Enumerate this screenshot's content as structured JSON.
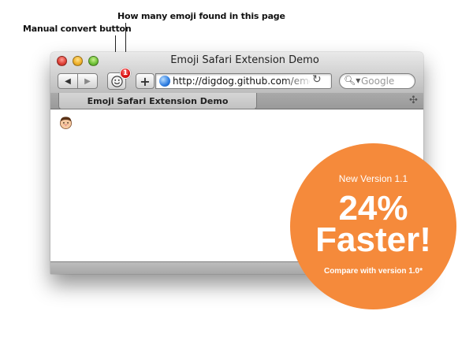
{
  "annotations": {
    "emoji_count": "How many emoji found in this page",
    "manual_convert": "Manual convert button"
  },
  "window": {
    "title": "Emoji Safari Extension Demo"
  },
  "toolbar": {
    "back_icon": "◀",
    "forward_icon": "▶",
    "emoji_button_icon": "smiley-face",
    "badge_count": "1",
    "add_button": "+",
    "url": "http://digdog.github.com/emoji",
    "reload_icon": "↻",
    "search_icon": "magnifier",
    "search_placeholder": "Google"
  },
  "tabbar": {
    "tab_title": "Emoji Safari Extension Demo",
    "new_tab_icon": "✣"
  },
  "promo": {
    "version": "New Version 1.1",
    "percent": "24%",
    "faster": "Faster!",
    "compare": "Compare with version 1.0*",
    "color": "#f58a3b"
  }
}
